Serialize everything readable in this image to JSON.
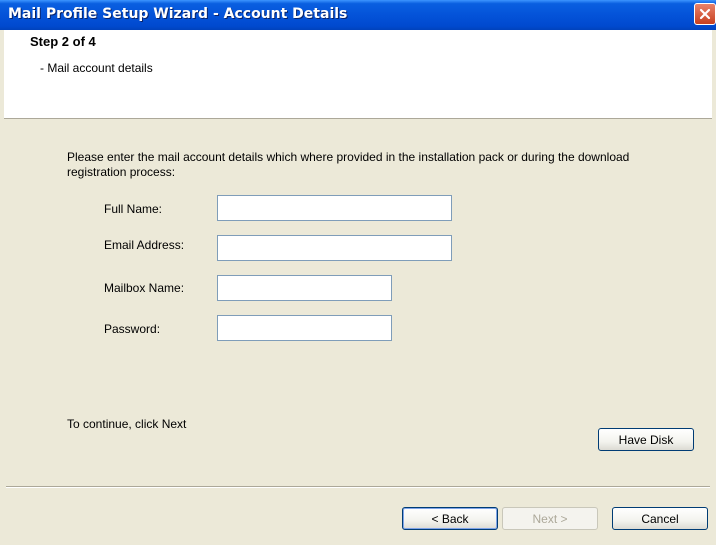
{
  "window": {
    "title": "Mail Profile Setup Wizard - Account Details"
  },
  "header": {
    "step": "Step 2 of 4",
    "subtitle": "- Mail account details"
  },
  "intro": "Please enter the mail account details which where provided in the installation pack or during the download registration process:",
  "form": {
    "full_name": {
      "label": "Full Name:",
      "value": ""
    },
    "email": {
      "label": "Email Address:",
      "value": ""
    },
    "mailbox": {
      "label": "Mailbox Name:",
      "value": ""
    },
    "password": {
      "label": "Password:",
      "value": ""
    }
  },
  "continue_hint": "To continue, click Next",
  "buttons": {
    "have_disk": "Have Disk",
    "back": "< Back",
    "next": "Next >",
    "cancel": "Cancel"
  },
  "icons": {
    "close": "close-icon"
  },
  "colors": {
    "titlebar": "#0453D9",
    "close": "#C7401F",
    "dialog_bg": "#ECE9D8"
  }
}
